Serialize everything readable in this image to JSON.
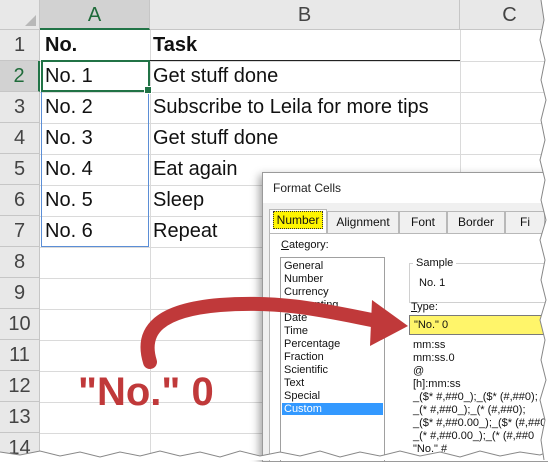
{
  "columns": [
    "A",
    "B",
    "C"
  ],
  "rows": [
    "1",
    "2",
    "3",
    "4",
    "5",
    "6",
    "7",
    "8",
    "9",
    "10",
    "11",
    "12",
    "13",
    "14"
  ],
  "cells": {
    "A1": "No.",
    "B1": "Task",
    "A2": "No.  1",
    "B2": "Get stuff done",
    "A3": "No.  2",
    "B3": "Subscribe to Leila for more tips",
    "A4": "No.  3",
    "B4": "Get stuff done",
    "A5": "No.  4",
    "B5": "Eat again",
    "A6": "No.  5",
    "B6": "Sleep",
    "A7": "No.  6",
    "B7": "Repeat"
  },
  "dialog": {
    "title": "Format Cells",
    "tabs": [
      "Number",
      "Alignment",
      "Font",
      "Border",
      "Fi"
    ],
    "category_label_underlined": "C",
    "category_label_rest": "ategory:",
    "categories": [
      "General",
      "Number",
      "Currency",
      "Accounting",
      "Date",
      "Time",
      "Percentage",
      "Fraction",
      "Scientific",
      "Text",
      "Special",
      "Custom"
    ],
    "selected_category": "Custom",
    "sample_label": "Sample",
    "sample_value": "No.  1",
    "type_label_underlined": "T",
    "type_label_rest": "ype:",
    "type_value": "\"No.\" 0",
    "formats": [
      "mm:ss",
      "mm:ss.0",
      "@",
      "[h]:mm:ss",
      "_($* #,##0_);_($* (#,##0);",
      "_(* #,##0_);_(* (#,##0);",
      "_($* #,##0.00_);_($* (#,##0",
      "_(* #,##0.00_);_(* (#,##0",
      "\"No.\" #"
    ]
  },
  "annotation": {
    "text": "\"No.\" 0",
    "color": "#c0393a"
  },
  "colors": {
    "excel_green": "#217346",
    "selection_blue": "#3399ff",
    "highlight_yellow": "#fff500"
  }
}
